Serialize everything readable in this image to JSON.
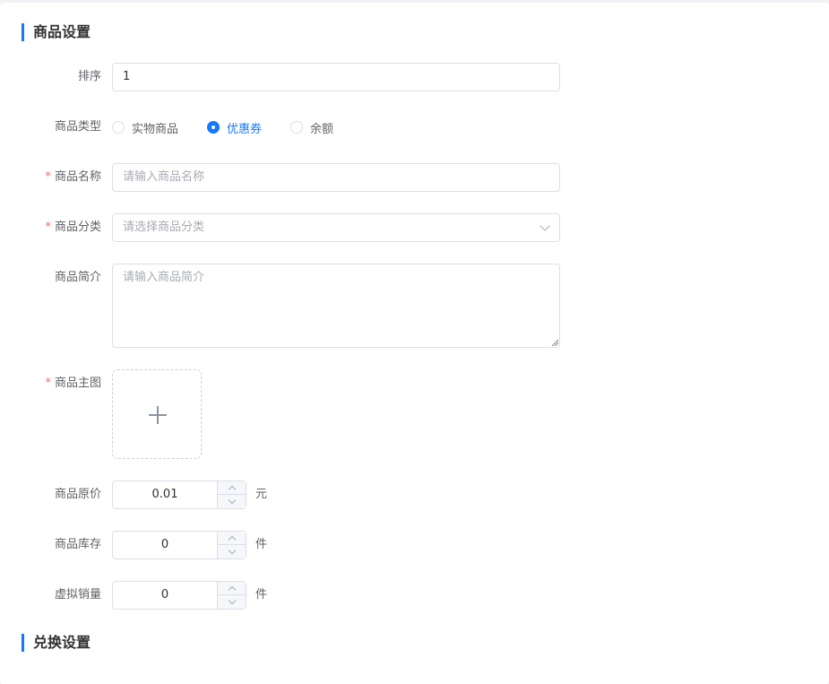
{
  "sections": {
    "goods_settings": "商品设置",
    "exchange_settings": "兑换设置"
  },
  "form": {
    "sort": {
      "label": "排序",
      "value": "1"
    },
    "type": {
      "label": "商品类型",
      "options": [
        "实物商品",
        "优惠券",
        "余额"
      ],
      "selected": "优惠券"
    },
    "name": {
      "label": "商品名称",
      "required": "*",
      "placeholder": "请输入商品名称"
    },
    "category": {
      "label": "商品分类",
      "required": "*",
      "placeholder": "请选择商品分类"
    },
    "intro": {
      "label": "商品简介",
      "placeholder": "请输入商品简介"
    },
    "main_image": {
      "label": "商品主图",
      "required": "*"
    },
    "original_price": {
      "label": "商品原价",
      "value": "0.01",
      "unit": "元"
    },
    "stock": {
      "label": "商品库存",
      "value": "0",
      "unit": "件"
    },
    "virtual_sales": {
      "label": "虚拟销量",
      "value": "0",
      "unit": "件"
    }
  },
  "colors": {
    "accent": "#1677ff",
    "required": "#f56c6c"
  },
  "icons": {
    "upload": "plus-icon",
    "select": "chevron-down-icon",
    "stepper_up": "chevron-up-icon",
    "stepper_down": "chevron-down-icon"
  }
}
